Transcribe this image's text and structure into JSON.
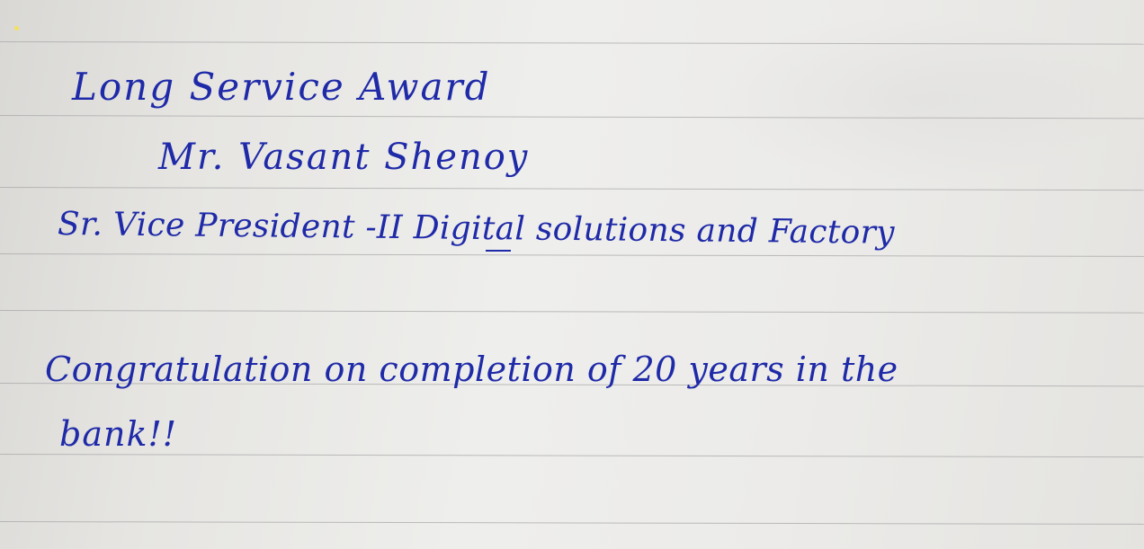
{
  "note": {
    "title": "Long Service Award",
    "name": "Mr. Vasant Shenoy",
    "role": "Sr. Vice President -II Digital solutions and Factory",
    "message_line1": "Congratulation on completion of 20 years in the",
    "message_line2": "bank!!"
  },
  "colors": {
    "ink": "#1f2aa8",
    "paper": "#ecebe9",
    "rule": "#a8a8a8"
  }
}
